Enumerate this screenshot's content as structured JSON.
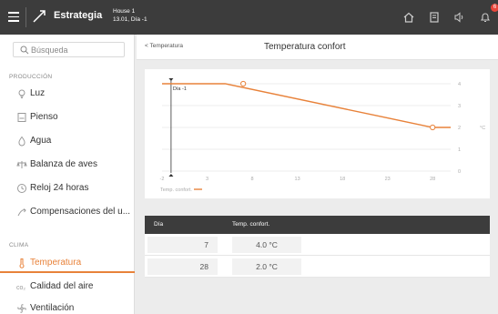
{
  "header": {
    "app_title": "Estrategia",
    "house": "House 1",
    "date": "13.01, Día -1",
    "notification_count": "6"
  },
  "sidebar": {
    "search_placeholder": "Búsqueda",
    "section1_title": "PRODUCCIÓN",
    "section1_items": [
      {
        "label": "Luz",
        "icon": "bulb-icon"
      },
      {
        "label": "Pienso",
        "icon": "feed-icon"
      },
      {
        "label": "Agua",
        "icon": "water-drop-icon"
      },
      {
        "label": "Balanza de aves",
        "icon": "scale-icon"
      },
      {
        "label": "Reloj 24 horas",
        "icon": "clock-icon"
      },
      {
        "label": "Compensaciones del u...",
        "icon": "compensation-icon"
      }
    ],
    "section2_title": "CLIMA",
    "section2_items": [
      {
        "label": "Temperatura",
        "icon": "thermometer-icon",
        "active": true
      },
      {
        "label": "Calidad del aire",
        "icon": "co2-icon"
      },
      {
        "label": "Ventilación",
        "icon": "fan-icon"
      }
    ]
  },
  "content": {
    "back_label": "< Temperatura",
    "title": "Temperatura confort"
  },
  "chart_data": {
    "type": "line",
    "x": [
      -2,
      5,
      28,
      30
    ],
    "series": [
      {
        "name": "Temp. confort.",
        "values": [
          4.0,
          4.0,
          2.0,
          2.0
        ],
        "color": "#e8823a"
      }
    ],
    "points_marked": [
      [
        7,
        4.0
      ],
      [
        28,
        2.0
      ]
    ],
    "xlim": [
      -2,
      30
    ],
    "ylim": [
      0,
      4
    ],
    "xticks": [
      "-2",
      "3",
      "8",
      "13",
      "18",
      "23",
      "28"
    ],
    "yticks": [
      "4",
      "3",
      "2",
      "1",
      "0"
    ],
    "current_day_label": "Día -1",
    "current_day": -1,
    "unit_label": "°C",
    "legend": "Temp. confort.",
    "grid": true
  },
  "table": {
    "headers": [
      "Día",
      "Temp. confort."
    ],
    "rows": [
      {
        "day": "7",
        "temp": "4.0 °C"
      },
      {
        "day": "28",
        "temp": "2.0 °C"
      }
    ]
  },
  "colors": {
    "accent": "#e8823a",
    "topbar": "#3c3c3c"
  }
}
